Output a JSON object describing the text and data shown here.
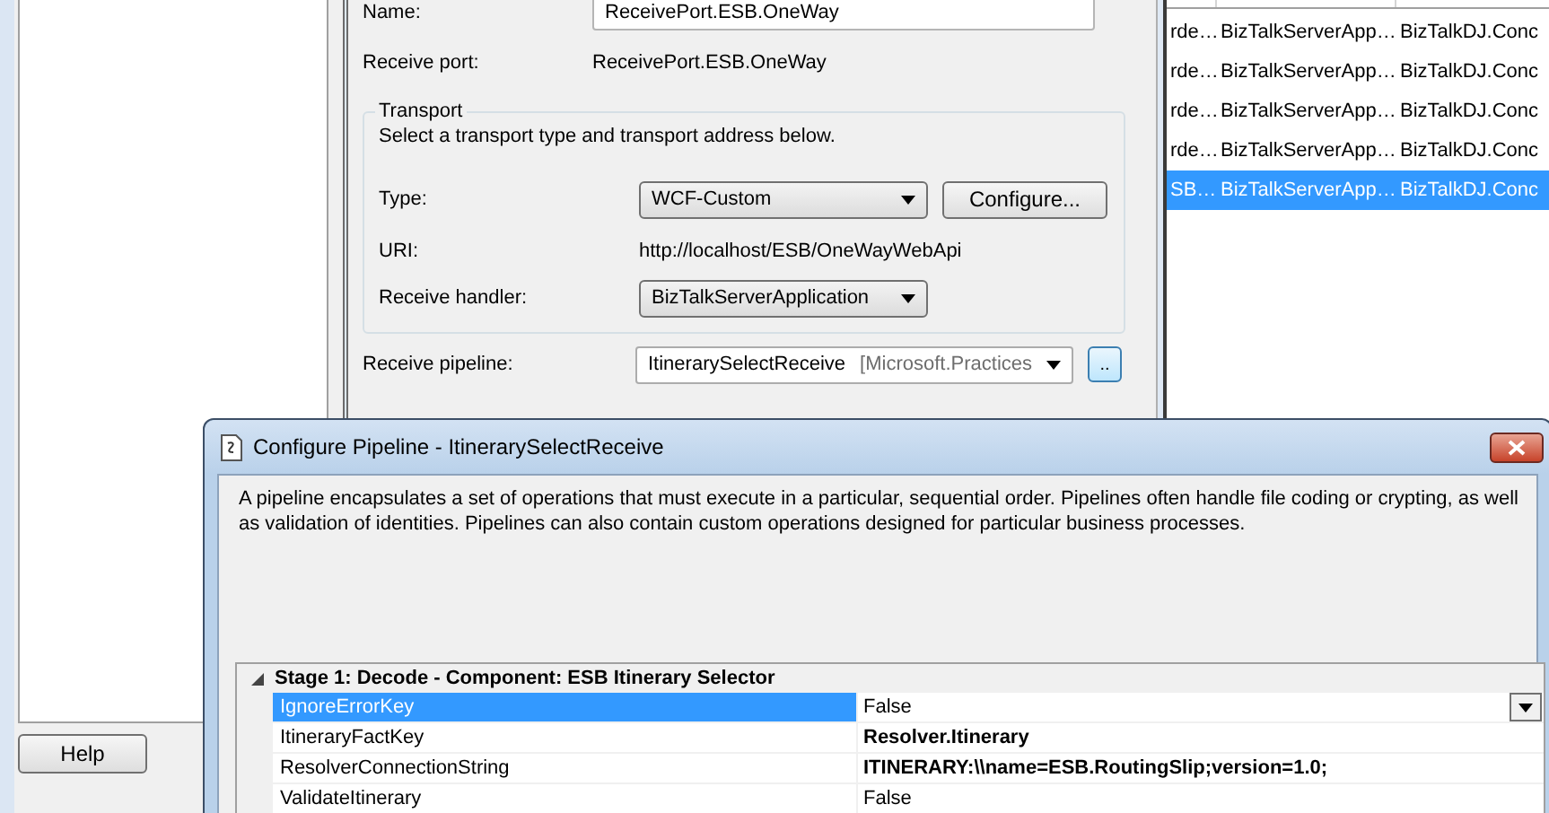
{
  "left_dialog": {
    "help_button": "Help"
  },
  "receive_location": {
    "name_label": "Name:",
    "name_value": "ReceivePort.ESB.OneWay",
    "receive_port_label": "Receive port:",
    "receive_port_value": "ReceivePort.ESB.OneWay",
    "transport": {
      "title": "Transport",
      "description": "Select a transport type and transport address below.",
      "type_label": "Type:",
      "type_value": "WCF-Custom",
      "configure_button": "Configure...",
      "uri_label": "URI:",
      "uri_value": "http://localhost/ESB/OneWayWebApi",
      "handler_label": "Receive handler:",
      "handler_value": "BizTalkServerApplication"
    },
    "pipeline_label": "Receive pipeline:",
    "pipeline_value": "ItinerarySelectReceive",
    "pipeline_assembly": "[Microsoft.Practices",
    "browse_button": ".."
  },
  "list": {
    "rows": [
      {
        "cells": [
          "rde…",
          "BizTalkServerApp…",
          "BizTalkDJ.Conc"
        ],
        "selected": false
      },
      {
        "cells": [
          "rde…",
          "BizTalkServerApp…",
          "BizTalkDJ.Conc"
        ],
        "selected": false
      },
      {
        "cells": [
          "rde…",
          "BizTalkServerApp…",
          "BizTalkDJ.Conc"
        ],
        "selected": false
      },
      {
        "cells": [
          "rde…",
          "BizTalkServerApp…",
          "BizTalkDJ.Conc"
        ],
        "selected": false
      },
      {
        "cells": [
          "SB…",
          "BizTalkServerApp…",
          "BizTalkDJ.Conc"
        ],
        "selected": true
      }
    ]
  },
  "pipeline_dialog": {
    "title": "Configure Pipeline - ItinerarySelectReceive",
    "description": "A pipeline encapsulates a set of operations that must execute in a particular, sequential order. Pipelines often handle file coding or crypting, as well as validation of identities. Pipelines can also contain custom operations designed for particular business processes.",
    "grid": {
      "categories": [
        {
          "title": "Stage 1: Decode - Component: ESB Itinerary Selector",
          "expanded": true,
          "properties": [
            {
              "name": "IgnoreErrorKey",
              "value": "False",
              "selected": true,
              "modified": false
            },
            {
              "name": "ItineraryFactKey",
              "value": "Resolver.Itinerary",
              "selected": false,
              "modified": true
            },
            {
              "name": "ResolverConnectionString",
              "value": "ITINERARY:\\\\name=ESB.RoutingSlip;version=1.0;",
              "selected": false,
              "modified": true
            },
            {
              "name": "ValidateItinerary",
              "value": "False",
              "selected": false,
              "modified": false
            }
          ]
        }
      ]
    }
  }
}
